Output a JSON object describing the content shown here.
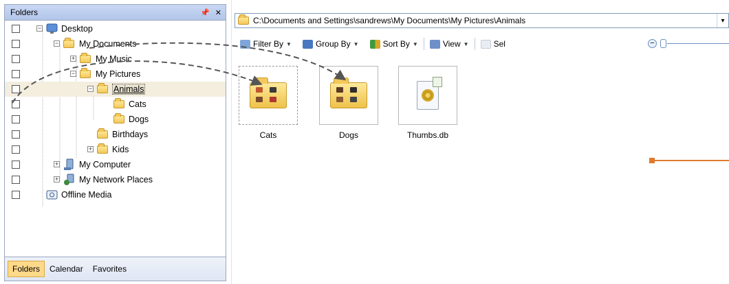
{
  "folders_pane": {
    "title": "Folders",
    "pin_icon": "pin-icon",
    "close_icon": "close-icon",
    "tree": [
      {
        "label": "Desktop",
        "icon": "desktop-icon"
      },
      {
        "label": "My Documents",
        "icon": "documents-folder-icon"
      },
      {
        "label": "My Music",
        "icon": "music-folder-icon"
      },
      {
        "label": "My Pictures",
        "icon": "pictures-folder-icon"
      },
      {
        "label": "Animals",
        "icon": "folder-icon",
        "selected": true
      },
      {
        "label": "Cats",
        "icon": "folder-icon"
      },
      {
        "label": "Dogs",
        "icon": "folder-icon"
      },
      {
        "label": "Birthdays",
        "icon": "folder-icon"
      },
      {
        "label": "Kids",
        "icon": "folder-icon"
      },
      {
        "label": "My Computer",
        "icon": "computer-icon"
      },
      {
        "label": "My Network Places",
        "icon": "network-icon"
      },
      {
        "label": "Offline Media",
        "icon": "offline-media-icon"
      }
    ],
    "tabs": [
      {
        "label": "Folders",
        "active": true
      },
      {
        "label": "Calendar",
        "active": false
      },
      {
        "label": "Favorites",
        "active": false
      }
    ]
  },
  "address": {
    "path": "C:\\Documents and Settings\\sandrews\\My Documents\\My Pictures\\Animals"
  },
  "toolbar": {
    "filter_by": "Filter By",
    "group_by": "Group By",
    "sort_by": "Sort By",
    "view": "View",
    "select": "Sel"
  },
  "items": [
    {
      "label": "Cats",
      "type": "folder"
    },
    {
      "label": "Dogs",
      "type": "folder"
    },
    {
      "label": "Thumbs.db",
      "type": "file"
    }
  ],
  "colors": {
    "accent": "#e07a2e",
    "selection": "#f4eedf",
    "active_tab": "#ffd98a"
  }
}
